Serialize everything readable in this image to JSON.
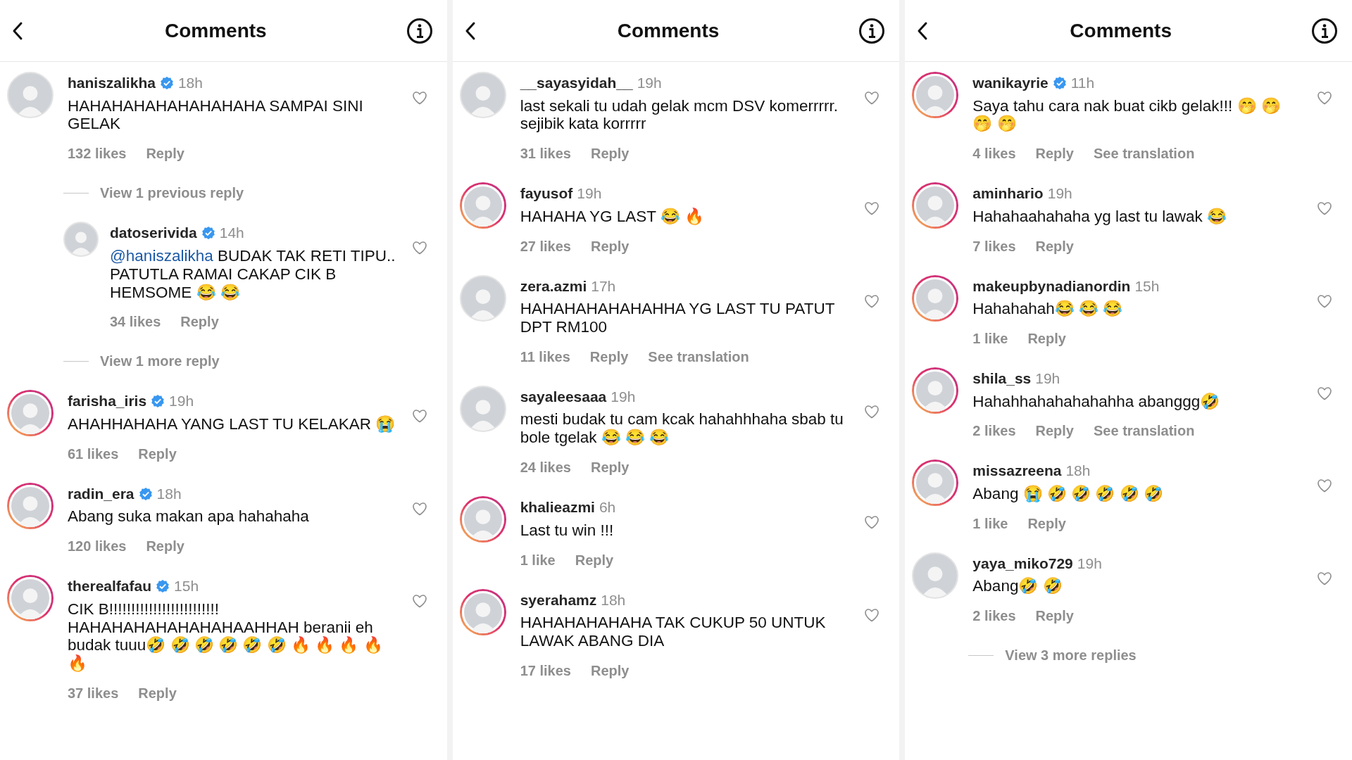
{
  "panels": [
    {
      "title": "Comments",
      "comments": [
        {
          "username": "haniszalikha",
          "verified": true,
          "time": "18h",
          "text": "HAHAHAHAHAHAHAHAHA SAMPAI SINI GELAK",
          "likes": "132 likes",
          "reply": "Reply",
          "story_ring": false,
          "children": [
            {
              "kind": "view_replies",
              "text": "View 1 previous reply"
            },
            {
              "kind": "comment",
              "username": "datoserivida",
              "verified": true,
              "time": "14h",
              "mention": "@haniszalikha",
              "text": " BUDAK TAK RETI TIPU.. PATUTLA RAMAI CAKAP CIK B HEMSOME 😂 😂",
              "likes": "34 likes",
              "reply": "Reply",
              "story_ring": false
            },
            {
              "kind": "view_replies",
              "text": "View 1 more reply"
            }
          ]
        },
        {
          "username": "farisha_iris",
          "verified": true,
          "time": "19h",
          "text": "AHAHHAHAHA YANG LAST TU KELAKAR 😭",
          "likes": "61 likes",
          "reply": "Reply",
          "story_ring": true
        },
        {
          "username": "radin_era",
          "verified": true,
          "time": "18h",
          "text": "Abang suka makan apa hahahaha",
          "likes": "120 likes",
          "reply": "Reply",
          "story_ring": true
        },
        {
          "username": "therealfafau",
          "verified": true,
          "time": "15h",
          "text": "CIK B!!!!!!!!!!!!!!!!!!!!!!!!! HAHAHAHAHAHAHAHAAHHAH beranii eh budak tuuu🤣 🤣 🤣 🤣 🤣 🤣 🔥 🔥 🔥 🔥 🔥",
          "likes": "37 likes",
          "reply": "Reply",
          "story_ring": true
        }
      ]
    },
    {
      "title": "Comments",
      "comments": [
        {
          "username": "__sayasyidah__",
          "verified": false,
          "time": "19h",
          "text": "last sekali tu udah gelak mcm DSV komerrrrr. sejibik kata korrrrr",
          "likes": "31 likes",
          "reply": "Reply",
          "story_ring": false
        },
        {
          "username": "fayusof",
          "verified": false,
          "time": "19h",
          "text": "HAHAHA YG LAST 😂 🔥",
          "likes": "27 likes",
          "reply": "Reply",
          "story_ring": true
        },
        {
          "username": "zera.azmi",
          "verified": false,
          "time": "17h",
          "text": "HAHAHAHAHAHAHHA YG LAST TU PATUT DPT RM100",
          "likes": "11 likes",
          "reply": "Reply",
          "translation": "See translation",
          "story_ring": false
        },
        {
          "username": "sayaleesaaa",
          "verified": false,
          "time": "19h",
          "text": "mesti budak tu cam kcak hahahhhaha sbab tu bole tgelak 😂 😂 😂",
          "likes": "24 likes",
          "reply": "Reply",
          "story_ring": false
        },
        {
          "username": "khalieazmi",
          "verified": false,
          "time": "6h",
          "text": "Last tu win !!!",
          "likes": "1 like",
          "reply": "Reply",
          "story_ring": true
        },
        {
          "username": "syerahamz",
          "verified": false,
          "time": "18h",
          "text": "HAHAHAHAHAHA TAK CUKUP 50 UNTUK LAWAK ABANG DIA",
          "likes": "17 likes",
          "reply": "Reply",
          "story_ring": true
        }
      ]
    },
    {
      "title": "Comments",
      "comments": [
        {
          "username": "wanikayrie",
          "verified": true,
          "time": "11h",
          "text": "Saya tahu cara nak buat cikb gelak!!! 🤭 🤭 🤭 🤭",
          "likes": "4 likes",
          "reply": "Reply",
          "translation": "See translation",
          "story_ring": true
        },
        {
          "username": "aminhario",
          "verified": false,
          "time": "19h",
          "text": "Hahahaahahaha yg last tu lawak 😂",
          "likes": "7 likes",
          "reply": "Reply",
          "story_ring": true
        },
        {
          "username": "makeupbynadianordin",
          "verified": false,
          "time": "15h",
          "text": "Hahahahah😂 😂 😂",
          "likes": "1 like",
          "reply": "Reply",
          "story_ring": true
        },
        {
          "username": "shila_ss",
          "verified": false,
          "time": "19h",
          "text": "Hahahhahahahahahha abanggg🤣",
          "likes": "2 likes",
          "reply": "Reply",
          "translation": "See translation",
          "story_ring": true
        },
        {
          "username": "missazreena",
          "verified": false,
          "time": "18h",
          "text": "Abang 😭 🤣 🤣 🤣 🤣 🤣",
          "likes": "1 like",
          "reply": "Reply",
          "story_ring": true
        },
        {
          "username": "yaya_miko729",
          "verified": false,
          "time": "19h",
          "text": "Abang🤣 🤣",
          "likes": "2 likes",
          "reply": "Reply",
          "story_ring": false,
          "children": [
            {
              "kind": "view_replies",
              "text": "View 3 more replies"
            }
          ]
        }
      ]
    }
  ]
}
